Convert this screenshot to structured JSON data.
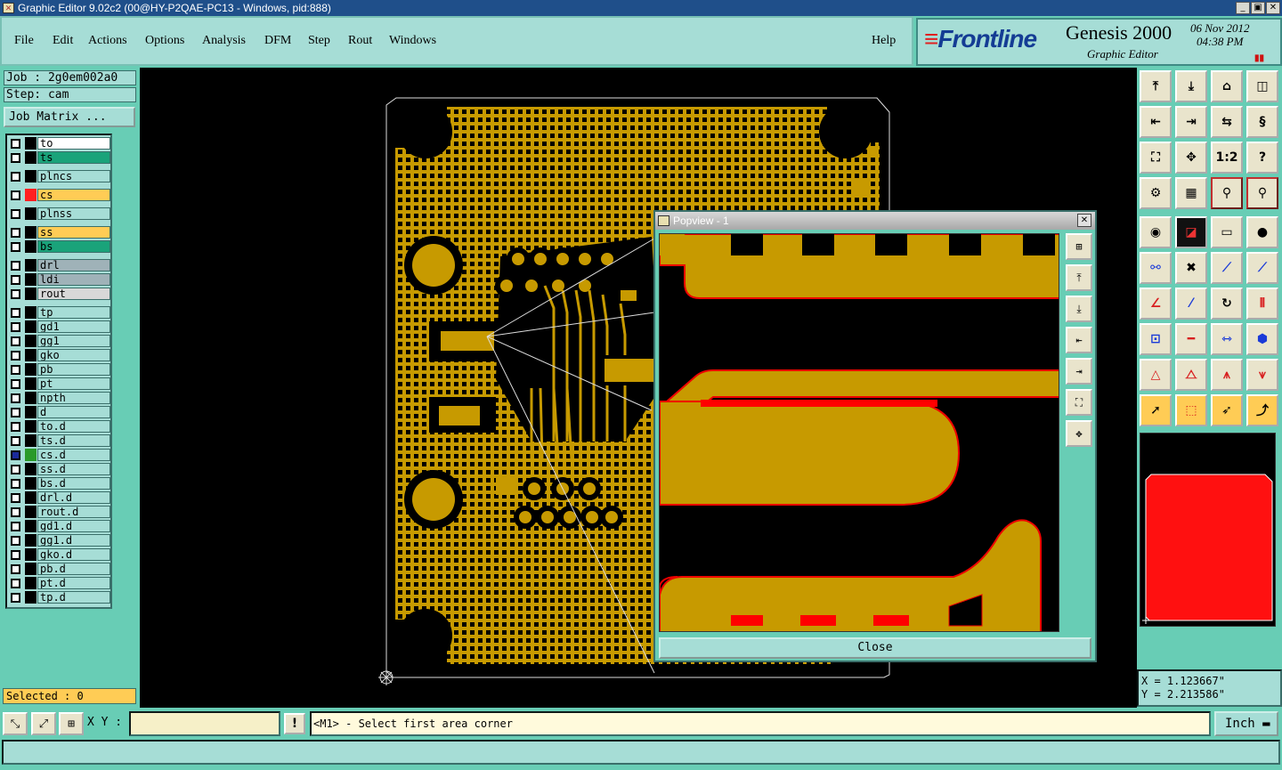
{
  "window": {
    "title": "Graphic Editor 9.02c2 (00@HY-P2QAE-PC13 - Windows, pid:888)"
  },
  "menu": {
    "items": [
      "File",
      "Edit",
      "Actions",
      "Options",
      "Analysis",
      "DFM",
      "Step",
      "Rout",
      "Windows"
    ],
    "help": "Help"
  },
  "branding": {
    "logo_text": "Frontline",
    "product": "Genesis 2000",
    "subtitle": "Graphic Editor",
    "date": "06 Nov 2012",
    "time": "04:38 PM"
  },
  "job": {
    "job_line": "Job : 2g0em002a0",
    "step_line": "Step: cam",
    "matrix_button": "Job Matrix ..."
  },
  "layers": [
    {
      "name": "to",
      "color": "#ffffff"
    },
    {
      "name": "ts",
      "color": "#1aa37a"
    },
    {
      "name": "plncs",
      "color": "#a6ddd6"
    },
    {
      "name": "cs",
      "color": "#ffcc55",
      "swatch": "#ff2020"
    },
    {
      "name": "plnss",
      "color": "#a6ddd6"
    },
    {
      "name": "ss",
      "color": "#ffcc55"
    },
    {
      "name": "bs",
      "color": "#1aa37a"
    },
    {
      "name": "drl",
      "color": "#9fb2b8"
    },
    {
      "name": "ldi",
      "color": "#9fb2b8"
    },
    {
      "name": "rout",
      "color": "#d8d8d8"
    },
    {
      "name": "tp",
      "color": "#a6ddd6"
    },
    {
      "name": "gd1",
      "color": "#a6ddd6"
    },
    {
      "name": "gg1",
      "color": "#a6ddd6"
    },
    {
      "name": "gko",
      "color": "#a6ddd6"
    },
    {
      "name": "pb",
      "color": "#a6ddd6"
    },
    {
      "name": "pt",
      "color": "#a6ddd6"
    },
    {
      "name": "npth",
      "color": "#a6ddd6"
    },
    {
      "name": "d",
      "color": "#a6ddd6"
    },
    {
      "name": "to.d",
      "color": "#a6ddd6"
    },
    {
      "name": "ts.d",
      "color": "#a6ddd6"
    },
    {
      "name": "cs.d",
      "color": "#a6ddd6",
      "swatch": "#2a9a2a",
      "selected": true
    },
    {
      "name": "ss.d",
      "color": "#a6ddd6"
    },
    {
      "name": "bs.d",
      "color": "#a6ddd6"
    },
    {
      "name": "drl.d",
      "color": "#a6ddd6"
    },
    {
      "name": "rout.d",
      "color": "#a6ddd6"
    },
    {
      "name": "gd1.d",
      "color": "#a6ddd6"
    },
    {
      "name": "gg1.d",
      "color": "#a6ddd6"
    },
    {
      "name": "gko.d",
      "color": "#a6ddd6"
    },
    {
      "name": "pb.d",
      "color": "#a6ddd6"
    },
    {
      "name": "pt.d",
      "color": "#a6ddd6"
    },
    {
      "name": "tp.d",
      "color": "#a6ddd6"
    }
  ],
  "status": {
    "selected": "Selected : 0"
  },
  "coords": {
    "x": "X = 1.123667\"",
    "y": "Y = 2.213586\""
  },
  "popview": {
    "title": "Popview - 1",
    "close_label": "Close"
  },
  "bottom": {
    "xy_label": "X Y :",
    "xy_value": "",
    "prompt": "<M1> - Select first area corner",
    "units": "Inch"
  },
  "toolbar": {
    "zoom_ratio": "1:2",
    "help_glyph": "?"
  },
  "colors": {
    "board": "#c79a00",
    "highlight": "#ff0000",
    "panel": "#68cdb5"
  }
}
